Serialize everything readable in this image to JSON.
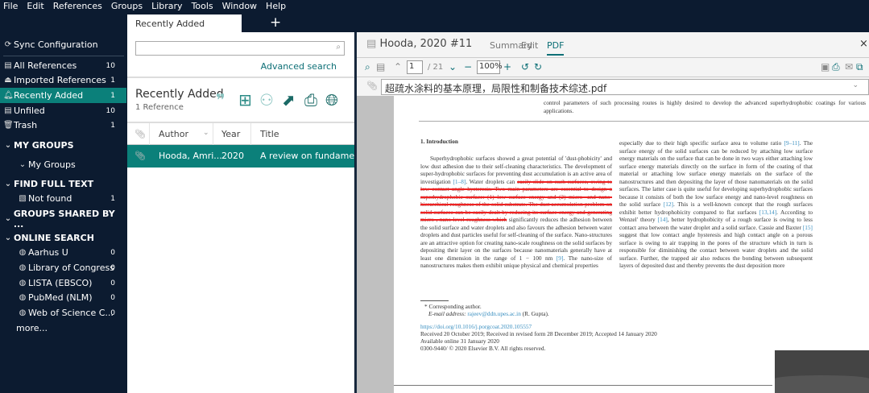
{
  "menu": [
    "File",
    "Edit",
    "References",
    "Groups",
    "Library",
    "Tools",
    "Window",
    "Help"
  ],
  "tab": {
    "label": "Recently Added",
    "add": "+"
  },
  "sidebar": {
    "sync": "Sync Configuration",
    "items": [
      {
        "label": "All References",
        "count": "10"
      },
      {
        "label": "Imported References",
        "count": "1"
      },
      {
        "label": "Recently Added",
        "count": "1"
      },
      {
        "label": "Unfiled",
        "count": "10"
      },
      {
        "label": "Trash",
        "count": "1"
      }
    ],
    "my_groups": {
      "header": "MY GROUPS",
      "item": "My Groups"
    },
    "find_full_text": {
      "header": "FIND FULL TEXT",
      "item": "Not found",
      "count": "1"
    },
    "groups_shared": "GROUPS SHARED BY ...",
    "online_search": {
      "header": "ONLINE SEARCH",
      "items": [
        {
          "label": "Aarhus U",
          "count": "0"
        },
        {
          "label": "Library of Congress",
          "count": "0"
        },
        {
          "label": "LISTA (EBSCO)",
          "count": "0"
        },
        {
          "label": "PubMed (NLM)",
          "count": "0"
        },
        {
          "label": "Web of Science C...",
          "count": "0"
        }
      ],
      "more": "more..."
    }
  },
  "library": {
    "search_placeholder": "",
    "advanced_search": "Advanced search",
    "group_title": "Recently Added",
    "group_count": "1 Reference",
    "columns": {
      "author": "Author",
      "year": "Year",
      "title": "Title"
    },
    "rows": [
      {
        "author": "Hooda, Amri...",
        "year": "2020",
        "title": "A review on fundamentals"
      }
    ]
  },
  "reference": {
    "title": "Hooda, 2020 #11",
    "tabs": [
      "Summary",
      "Edit",
      "PDF"
    ],
    "active_tab": "PDF",
    "page": "1",
    "page_total": "/ 21",
    "zoom": "100%",
    "file": "超疏水涂料的基本原理，局限性和制备技术综述.pdf"
  },
  "pdf": {
    "abstract_end": "control parameters of such processing routes is highly desired to develop the advanced superhydrophobic coatings for various applications.",
    "heading": "1.  Introduction",
    "left_a": "Superhydrophobic surfaces showed a great potential of 'dust-phobicity' and low dust adhesion due to their self-cleaning characteristics. The development of super-hydrophobic surfaces for preventing dust accumulation is an active area of investigation ",
    "left_ref1": "[1–8]",
    "left_b": ". Water droplets can ",
    "left_struck": "easily slide on such surfaces, owing to low contact angle hysteresis. Two main parameters are essential to design a superhydrophobic surface: (1) low surface energy and (2) micro- and nano-hierarchical roughness of the solid substrate. The dust accumulation problem on solid surfaces can be easily dealt by reducing its surface energy and generating micro-, nano-level roughness which",
    "left_c": " significantly reduces the adhesion between the solid surface and water droplets and also favours the adhesion between water droplets and dust particles useful for self-cleaning of the surface. Nano-structures are an attractive option for creating nano-scale roughness on the solid surfaces by depositing their layer on the surfaces because nanomaterials generally have at least one dimension in the range of 1 − 100 nm ",
    "left_ref2": "[9]",
    "left_d": ". The nano-size of nanostructures makes them exhibit unique physical and chemical properties",
    "right_a": "especially due to their high specific surface area to volume ratio ",
    "right_ref1": "[9–11]",
    "right_b": ". The surface energy of the solid surfaces can be reduced by attaching low surface energy materials on the surface that can be done in two ways either attaching low surface energy materials directly on the surface in form of the coating of that material or attaching low surface energy materials on the surface of the nanostructures and then depositing the layer of those nanomaterials on the solid surfaces. The latter case is quite useful for developing superhydrophobic surfaces because it consists of both the low surface energy and nano-level roughness on the solid surface ",
    "right_ref2": "[12]",
    "right_c": ". This is a well-known concept that the rough surfaces exhibit better hydrophobicity compared to flat surfaces ",
    "right_ref3": "[13,14]",
    "right_d": ". According to Wenzel' theory ",
    "right_ref4": "[14]",
    "right_e": ", better hydrophobicity of a rough surface is owing to less contact area between the water droplet and a solid surface. Cassie and Baxter ",
    "right_ref5": "[15]",
    "right_f": " suggest that low contact angle hysteresis and high contact angle on a porous surface is owing to air trapping in the pores of the structure which in turn is responsible for diminishing the contact between water droplets and the solid surface. Further, the trapped air also reduces the bonding between subsequent layers of deposited dust and thereby prevents the dust deposition more",
    "footnote_corr": "* Corresponding author.",
    "footnote_email_label": "E-mail address: ",
    "footnote_email": "rajeev@ddn.upes.ac.in",
    "footnote_email_name": " (R. Gupta).",
    "doi": "https://doi.org/10.1016/j.porgcoat.2020.105557",
    "received": "Received 20 October 2019; Received in revised form 28 December 2019; Accepted 14 January 2020",
    "available": "Available online 31 January 2020",
    "copyright": "0300-9440/ © 2020 Elsevier B.V. All rights reserved."
  },
  "colors": {
    "navy": "#0c1b30",
    "teal": "#0b807a",
    "strike": "#e22222"
  }
}
